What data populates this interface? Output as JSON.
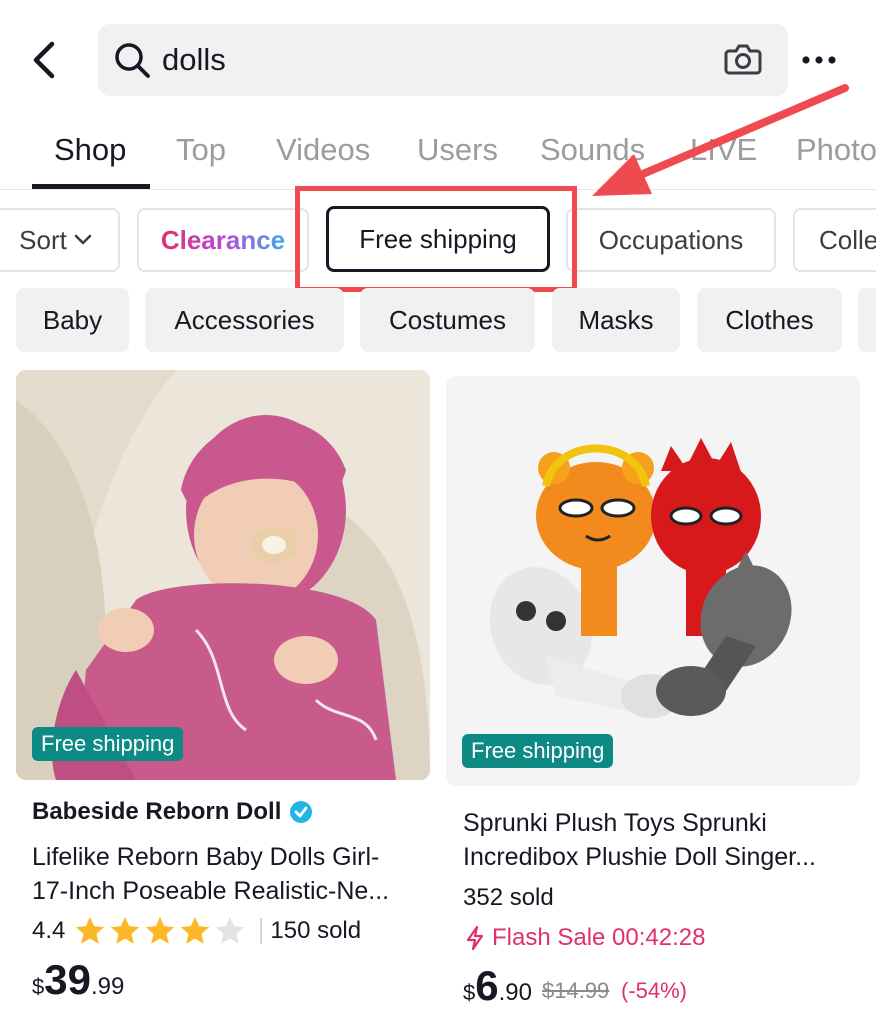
{
  "search": {
    "value": "dolls"
  },
  "tabs": [
    "Shop",
    "Top",
    "Videos",
    "Users",
    "Sounds",
    "LIVE",
    "Photo"
  ],
  "filters": {
    "sort": "Sort",
    "clearance": "Clearance",
    "free_shipping": "Free shipping",
    "occupations": "Occupations",
    "collections": "Colle"
  },
  "categories": [
    "Baby",
    "Accessories",
    "Costumes",
    "Masks",
    "Clothes"
  ],
  "products": [
    {
      "badge": "Free shipping",
      "seller": "Babeside Reborn Doll",
      "title_line1": "Lifelike Reborn Baby Dolls Girl-",
      "title_line2": "17-Inch Poseable Realistic-Ne...",
      "rating": "4.4",
      "rating_value": 4.4,
      "sold": "150 sold",
      "price": {
        "currency": "$",
        "int": "39",
        "dec": ".99"
      }
    },
    {
      "badge": "Free shipping",
      "title_line1": "Sprunki Plush Toys Sprunki",
      "title_line2": "Incredibox Plushie Doll Singer...",
      "sold": "352 sold",
      "flash": "Flash Sale 00:42:28",
      "price": {
        "currency": "$",
        "int": "6",
        "dec": ".90"
      },
      "original_price": "$14.99",
      "discount": "(-54%)"
    }
  ],
  "colors": {
    "accent_pink": "#e0306a",
    "badge_teal": "#0d8a83",
    "annotation_red": "#ef4a4f",
    "star": "#fcb826"
  }
}
